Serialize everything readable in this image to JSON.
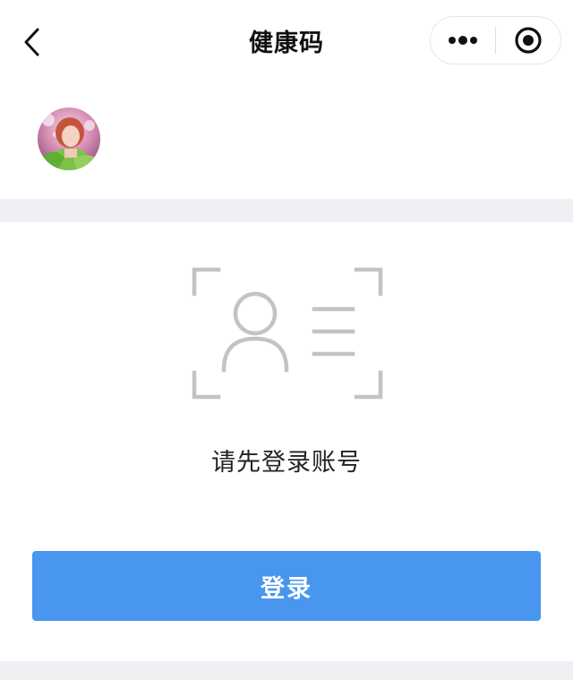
{
  "navbar": {
    "title": "健康码",
    "back_icon": "chevron-left-icon",
    "more_icon": "more-dots-icon",
    "close_icon": "target-circle-icon"
  },
  "profile": {
    "avatar_icon": "user-avatar-photo"
  },
  "login_card": {
    "illustration_icon": "id-card-scan-icon",
    "prompt": "请先登录账号",
    "login_label": "登录"
  },
  "colors": {
    "primary": "#4896ee",
    "separator": "#efeff4",
    "illustration": "#c3c3c3",
    "text": "#222222"
  }
}
